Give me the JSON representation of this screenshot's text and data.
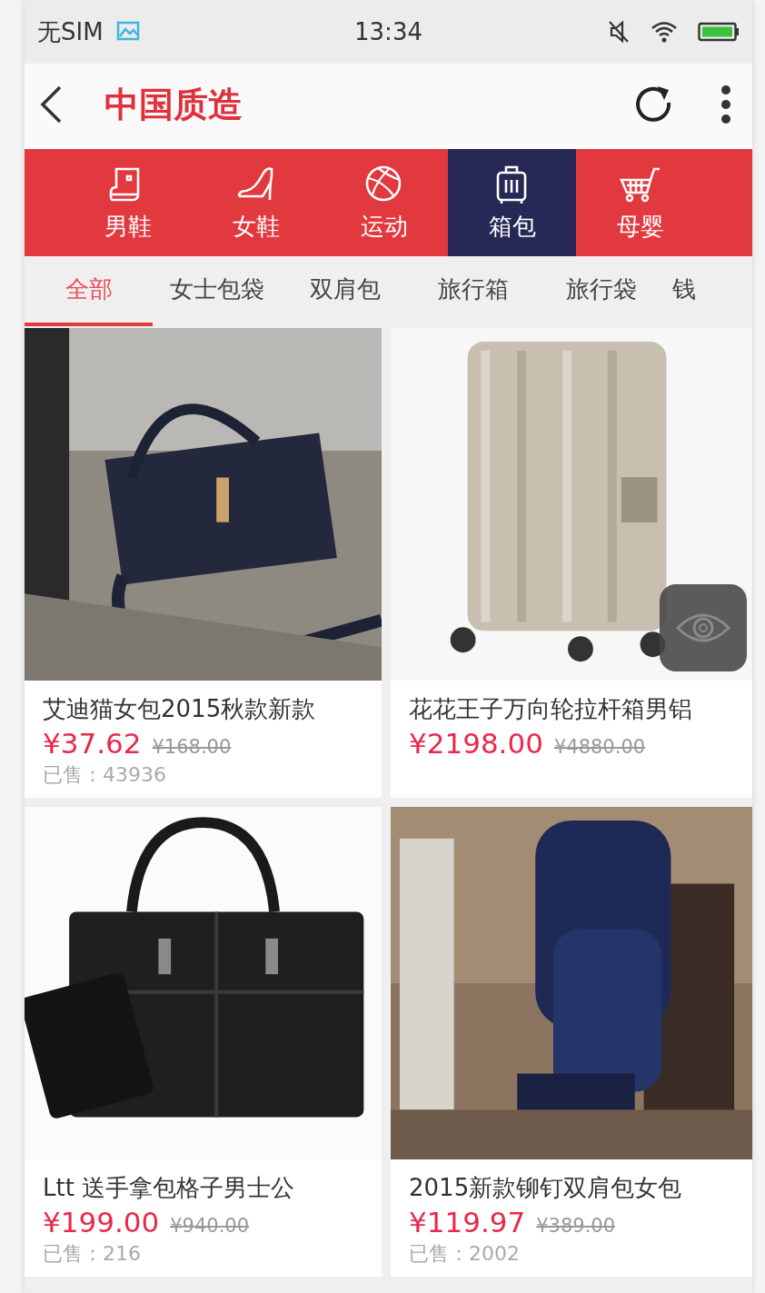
{
  "status_bar": {
    "carrier": "无SIM",
    "time": "13:34"
  },
  "header": {
    "title": "中国质造"
  },
  "categories": [
    {
      "label": "男鞋",
      "selected": false
    },
    {
      "label": "女鞋",
      "selected": false
    },
    {
      "label": "运动",
      "selected": false
    },
    {
      "label": "箱包",
      "selected": true
    },
    {
      "label": "母婴",
      "selected": false
    }
  ],
  "subtabs": [
    {
      "label": "全部",
      "selected": true
    },
    {
      "label": "女士包袋",
      "selected": false
    },
    {
      "label": "双肩包",
      "selected": false
    },
    {
      "label": "旅行箱",
      "selected": false
    },
    {
      "label": "旅行袋",
      "selected": false
    },
    {
      "label": "钱",
      "selected": false
    }
  ],
  "products": [
    {
      "name": "艾迪猫女包2015秋款新款",
      "price": "¥37.62",
      "original_price": "¥168.00",
      "sold": "已售：43936"
    },
    {
      "name": "花花王子万向轮拉杆箱男铝",
      "price": "¥2198.00",
      "original_price": "¥4880.00"
    },
    {
      "name": "Ltt 送手拿包格子男士公",
      "price": "¥199.00",
      "original_price": "¥940.00",
      "sold": "已售：216"
    },
    {
      "name": "2015新款铆钉双肩包女包",
      "price": "¥119.97",
      "original_price": "¥389.00",
      "sold": "已售：2002"
    }
  ]
}
